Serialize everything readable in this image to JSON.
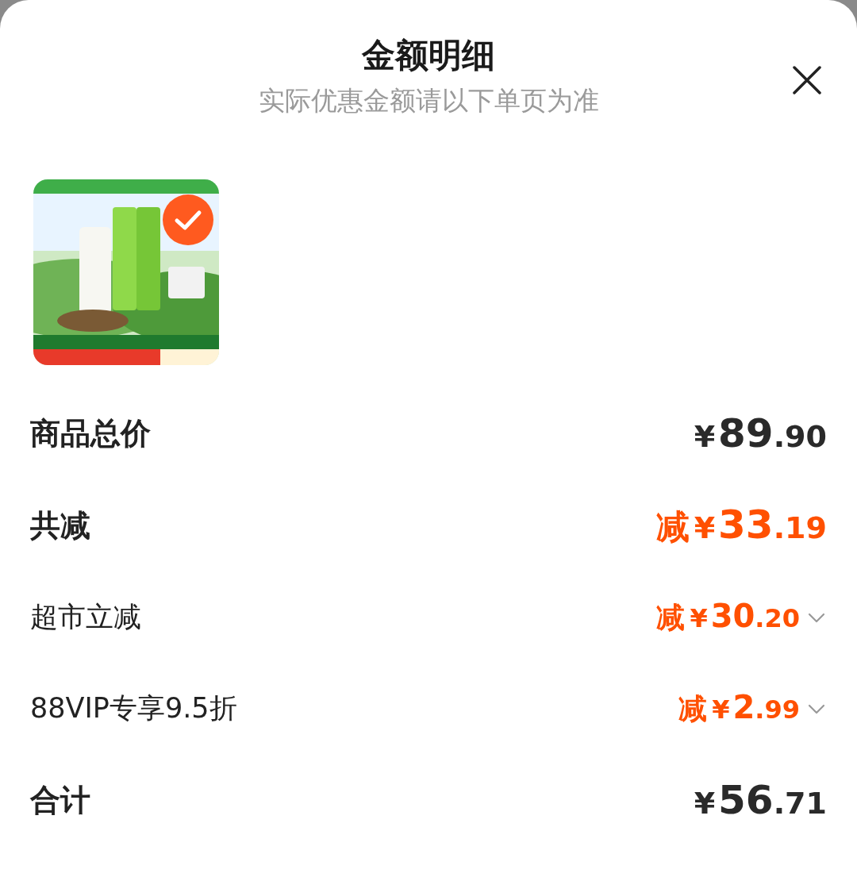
{
  "header": {
    "title": "金额明细",
    "subtitle": "实际优惠金额请以下单页为准"
  },
  "product": {
    "kind": "picture",
    "selected": true
  },
  "rows": [
    {
      "kind": "main",
      "label": "商品总价",
      "color": "#2a2a2a",
      "prefix": "",
      "currency": "¥",
      "integer": "89",
      "decimal": ".90"
    },
    {
      "kind": "main",
      "label": "共减",
      "color": "#ff5000",
      "prefix": "减",
      "currency": "¥",
      "integer": "33",
      "decimal": ".19"
    },
    {
      "kind": "sub",
      "label": "超市立减",
      "color": "#ff5000",
      "prefix": "减",
      "currency": "¥",
      "integer": "30",
      "decimal": ".20",
      "expanded": false
    },
    {
      "kind": "sub",
      "label": "88VIP专享9.5折",
      "color": "#ff5000",
      "prefix": "减",
      "currency": "¥",
      "integer": "2",
      "decimal": ".99",
      "expanded": false
    },
    {
      "kind": "main",
      "label": "合计",
      "color": "#2a2a2a",
      "prefix": "",
      "currency": "¥",
      "integer": "56",
      "decimal": ".71"
    }
  ]
}
